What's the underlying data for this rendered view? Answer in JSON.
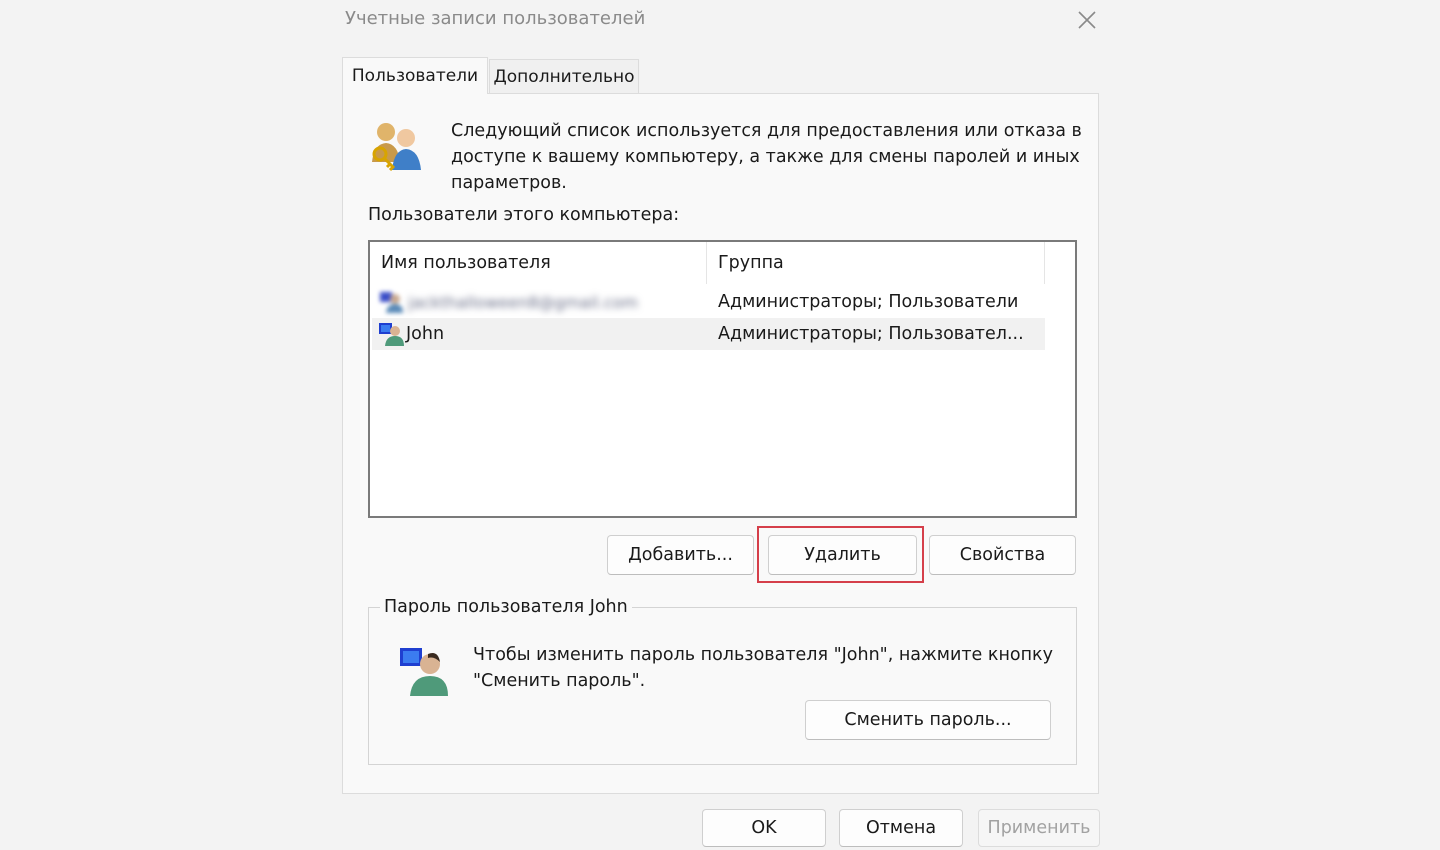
{
  "window": {
    "title": "Учетные записи пользователей"
  },
  "tabs": [
    {
      "label": "Пользователи",
      "active": true
    },
    {
      "label": "Дополнительно",
      "active": false
    }
  ],
  "intro": {
    "text": "Следующий список используется для предоставления или отказа в доступе к вашему компьютеру, а также для смены паролей и иных параметров."
  },
  "users_section": {
    "label": "Пользователи этого компьютера:",
    "columns": [
      "Имя пользователя",
      "Группа"
    ],
    "rows": [
      {
        "name": "jackthalloween8@gmail.com",
        "group": "Администраторы; Пользователи",
        "blurred": true
      },
      {
        "name": "John",
        "group": "Администраторы; Пользовател...",
        "selected": true
      }
    ]
  },
  "buttons": {
    "add": "Добавить...",
    "remove": "Удалить",
    "properties": "Свойства",
    "change_password": "Сменить пароль...",
    "ok": "OK",
    "cancel": "Отмена",
    "apply": "Применить"
  },
  "password_group": {
    "label": "Пароль пользователя John",
    "text": "Чтобы изменить пароль пользователя \"John\", нажмите кнопку \"Сменить пароль\"."
  },
  "colors": {
    "highlight": "#d53f4a",
    "disabled_text": "#a2a2a2"
  }
}
